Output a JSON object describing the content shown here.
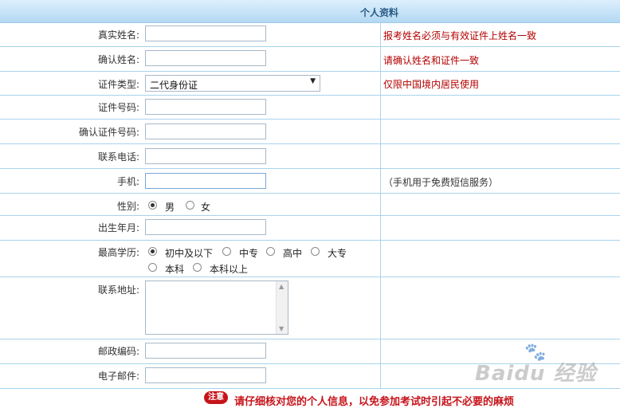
{
  "header": {
    "title": "个人资料"
  },
  "fields": {
    "real_name": {
      "label": "真实姓名:",
      "hint": "报考姓名必须与有效证件上姓名一致"
    },
    "confirm_name": {
      "label": "确认姓名:",
      "hint": "请确认姓名和证件一致"
    },
    "id_type": {
      "label": "证件类型:",
      "value": "二代身份证",
      "hint": "仅限中国境内居民使用"
    },
    "id_number": {
      "label": "证件号码:"
    },
    "confirm_id_number": {
      "label": "确认证件号码:"
    },
    "phone": {
      "label": "联系电话:"
    },
    "mobile": {
      "label": "手机:",
      "hint": "（手机用于免费短信服务）"
    },
    "gender": {
      "label": "性别:",
      "options": [
        "男",
        "女"
      ],
      "selected": "男"
    },
    "birth": {
      "label": "出生年月:"
    },
    "education": {
      "label": "最高学历:",
      "options": [
        "初中及以下",
        "中专",
        "高中",
        "大专",
        "本科",
        "本科以上"
      ],
      "selected": "初中及以下"
    },
    "address": {
      "label": "联系地址:"
    },
    "postcode": {
      "label": "邮政编码:"
    },
    "email": {
      "label": "电子邮件:"
    }
  },
  "notice": {
    "badge": "注意",
    "text": "请仔细核对您的个人信息，以免参加考试时引起不必要的麻烦"
  },
  "watermark": {
    "text": "Baidu 经验"
  },
  "colors": {
    "hint_red": "#b40000",
    "notice_red": "#c6141b",
    "header_blue": "#b3d8f3",
    "grid_line": "#a9d3ec"
  }
}
